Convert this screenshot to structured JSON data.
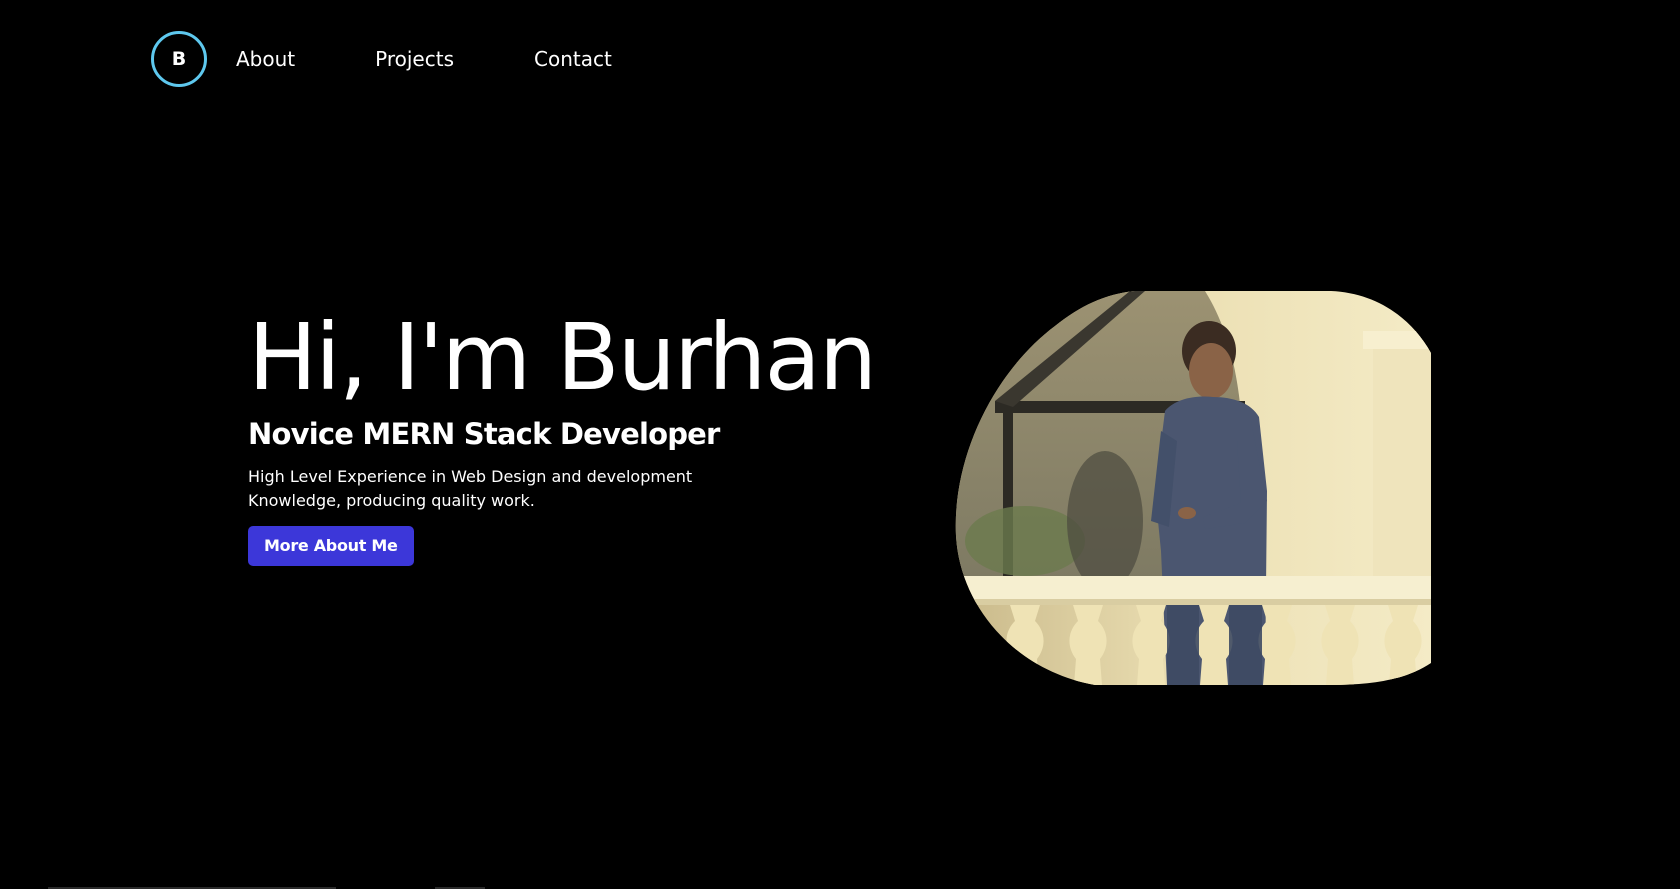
{
  "nav": {
    "logo_letter": "B",
    "links": [
      "About",
      "Projects",
      "Contact"
    ]
  },
  "hero": {
    "title": "Hi, I'm Burhan",
    "subtitle": "Novice MERN Stack Developer",
    "description_lines": [
      "High Level Experience in Web Design and development",
      "Knowledge, producing quality work."
    ],
    "cta_label": "More About Me"
  },
  "colors": {
    "background": "#000000",
    "logo_ring": "#5ec8ee",
    "cta": "#3c37d9",
    "text": "#ffffff"
  }
}
